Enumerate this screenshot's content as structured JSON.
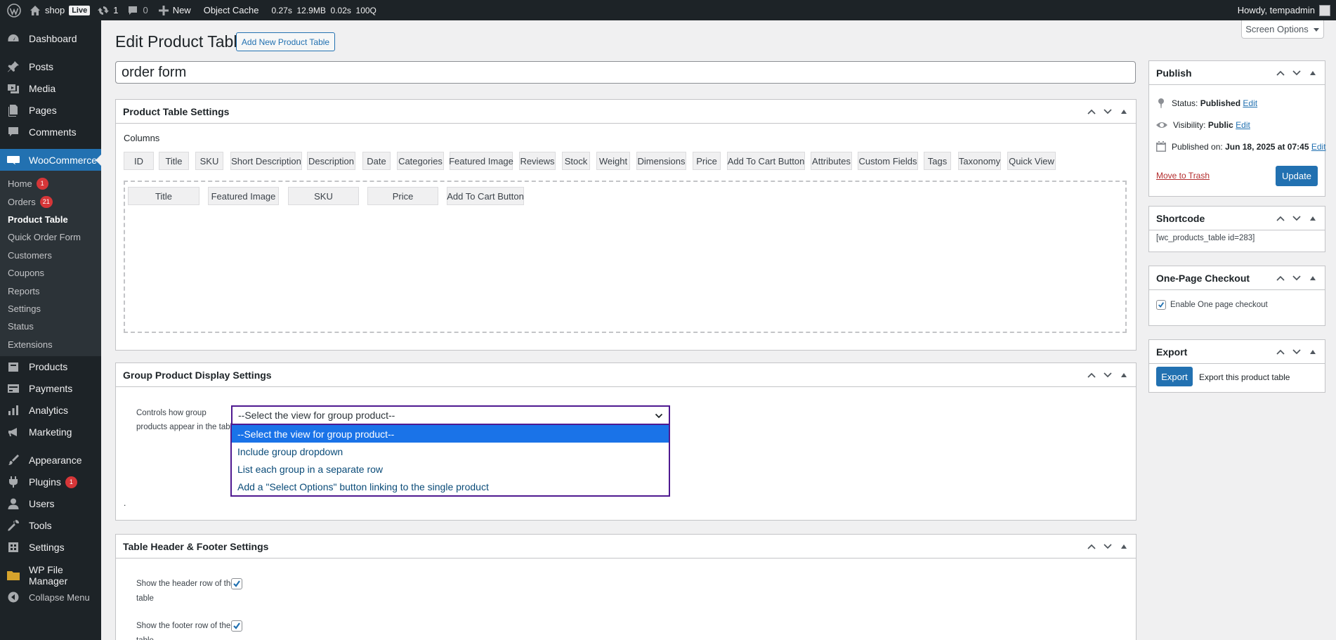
{
  "admin_bar": {
    "site_name": "shop",
    "live_label": "Live",
    "updates_count": "1",
    "comments_count": "0",
    "new_label": "New",
    "object_cache_label": "Object Cache",
    "query_monitor": "0.27s  12.9MB  0.02s  100Q",
    "howdy": "Howdy, tempadmin"
  },
  "sidebar": {
    "dashboard": "Dashboard",
    "posts": "Posts",
    "media": "Media",
    "pages": "Pages",
    "comments": "Comments",
    "woocommerce": "WooCommerce",
    "woo_sub": [
      {
        "label": "Home",
        "count": "1"
      },
      {
        "label": "Orders",
        "count": "21"
      },
      {
        "label": "Product Table"
      },
      {
        "label": "Quick Order Form"
      },
      {
        "label": "Customers"
      },
      {
        "label": "Coupons"
      },
      {
        "label": "Reports"
      },
      {
        "label": "Settings"
      },
      {
        "label": "Status"
      },
      {
        "label": "Extensions"
      }
    ],
    "products": "Products",
    "payments": "Payments",
    "analytics": "Analytics",
    "marketing": "Marketing",
    "appearance": "Appearance",
    "plugins": "Plugins",
    "plugins_count": "1",
    "users": "Users",
    "tools": "Tools",
    "settings": "Settings",
    "wp_file_manager": "WP File Manager",
    "collapse": "Collapse Menu"
  },
  "page": {
    "title": "Edit Product Table",
    "add_new": "Add New Product Table",
    "screen_options": "Screen Options",
    "post_title": "order form"
  },
  "settings_box": {
    "title": "Product Table Settings",
    "columns_label": "Columns",
    "available_columns": [
      "ID",
      "Title",
      "SKU",
      "Short Description",
      "Description",
      "Date",
      "Categories",
      "Featured Image",
      "Reviews",
      "Stock",
      "Weight",
      "Dimensions",
      "Price",
      "Add To Cart Button",
      "Attributes",
      "Custom Fields",
      "Tags",
      "Taxonomy",
      "Quick View"
    ],
    "selected_columns": [
      "Title",
      "Featured Image",
      "SKU",
      "Price",
      "Add To Cart Button"
    ]
  },
  "group_box": {
    "title": "Group Product Display Settings",
    "label_line1": "Controls how group",
    "label_line2": "products appear in the table",
    "selected": "--Select the view for group product--",
    "options": [
      "--Select the view for group product--",
      "Include group dropdown",
      "List each group in a separate row",
      "Add a \"Select Options\" button linking to the single product"
    ],
    "dot": "."
  },
  "header_footer_box": {
    "title": "Table Header & Footer Settings",
    "header_label_1": "Show the header row of the",
    "header_label_2": "table",
    "header_checked": true,
    "footer_label_1": "Show the footer row of the",
    "footer_label_2": "table",
    "footer_checked": true
  },
  "publish": {
    "title": "Publish",
    "status_label": "Status:",
    "status_value": "Published",
    "visibility_label": "Visibility:",
    "visibility_value": "Public",
    "published_label": "Published on:",
    "published_value": "Jun 18, 2025 at 07:45",
    "edit": "Edit",
    "trash": "Move to Trash",
    "update": "Update"
  },
  "shortcode": {
    "title": "Shortcode",
    "value": "[wc_products_table id=283]"
  },
  "one_page": {
    "title": "One-Page Checkout",
    "label": "Enable One page checkout",
    "checked": true
  },
  "export": {
    "title": "Export",
    "button": "Export",
    "label": "Export this product table"
  },
  "colors": {
    "admin_dark": "#1d2327",
    "accent": "#2271b1",
    "badge_red": "#d63638",
    "select_border": "#4f1990",
    "option_highlight": "#1a73e8"
  }
}
